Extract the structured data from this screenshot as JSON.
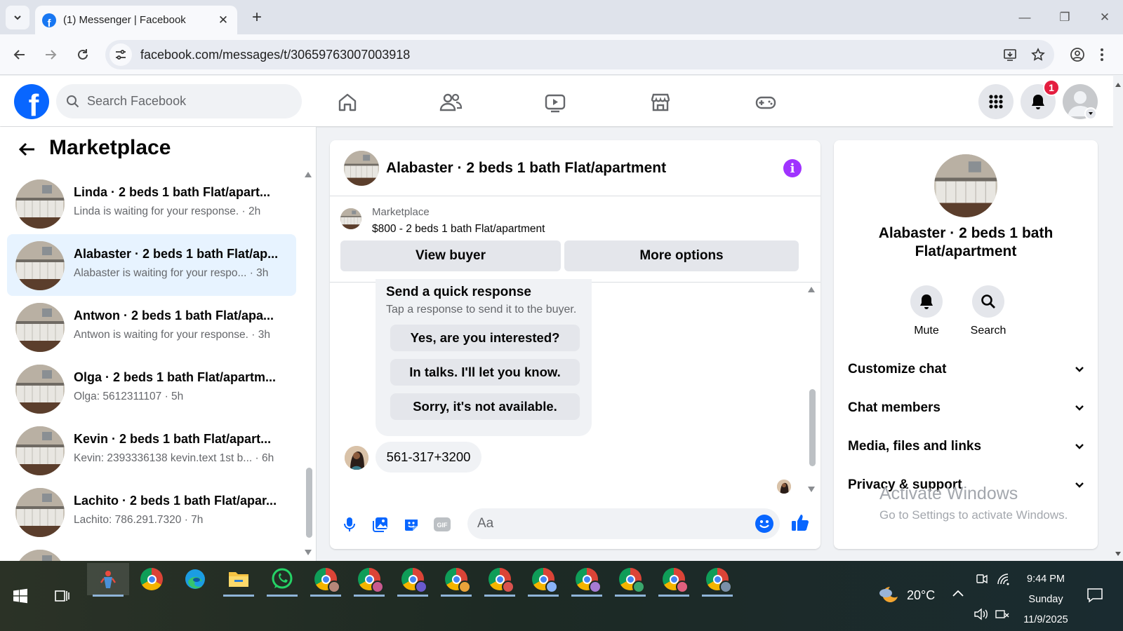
{
  "browser": {
    "tab_title": "(1) Messenger | Facebook",
    "url": "facebook.com/messages/t/30659763007003918"
  },
  "header": {
    "search_placeholder": "Search Facebook",
    "notification_count": "1"
  },
  "left": {
    "title": "Marketplace",
    "conversations": [
      {
        "name": "Linda · 2 beds 1 bath Flat/apart...",
        "snippet": "Linda is waiting for your response. · 2h"
      },
      {
        "name": "Alabaster · 2 beds 1 bath Flat/ap...",
        "snippet": "Alabaster is waiting for your respo... · 3h"
      },
      {
        "name": "Antwon · 2 beds 1 bath Flat/apa...",
        "snippet": "Antwon is waiting for your response. · 3h"
      },
      {
        "name": "Olga · 2 beds 1 bath Flat/apartm...",
        "snippet": "Olga: 5612311107 · 5h"
      },
      {
        "name": "Kevin · 2 beds 1 bath Flat/apart...",
        "snippet": "Kevin: 2393336138 kevin.text 1st b... · 6h"
      },
      {
        "name": "Lachito · 2 beds 1 bath Flat/apar...",
        "snippet": "Lachito: 786.291.7320 · 7h"
      }
    ]
  },
  "chat": {
    "title": "Alabaster · 2 beds 1 bath Flat/apartment",
    "listing_source": "Marketplace",
    "listing_price": "$800 - 2 beds 1 bath Flat/apartment",
    "view_buyer": "View buyer",
    "more_options": "More options",
    "quick_title": "Send a quick response",
    "quick_subtitle": "Tap a response to send it to the buyer.",
    "quick_replies": [
      "Yes, are you interested?",
      "In talks. I'll let you know.",
      "Sorry, it's not available."
    ],
    "message": "561-317+3200",
    "input_placeholder": "Aa"
  },
  "right": {
    "title": "Alabaster · 2 beds 1 bath Flat/apartment",
    "mute": "Mute",
    "search": "Search",
    "sections": [
      "Customize chat",
      "Chat members",
      "Media, files and links",
      "Privacy & support"
    ],
    "watermark_title": "Activate Windows",
    "watermark_sub": "Go to Settings to activate Windows."
  },
  "taskbar": {
    "temperature": "20°C",
    "time": "9:44 PM",
    "day": "Sunday",
    "date": "11/9/2025",
    "profile_colors": [
      "#b5877a",
      "#c85a8f",
      "#6a5acd",
      "#e8a23a",
      "#d9534f",
      "#8ab4f8",
      "#a67bd4",
      "#3aa76d",
      "#e0607e",
      "#7a8fa8"
    ]
  },
  "colors": {
    "brand": "#0866ff",
    "active_row": "#e7f3ff",
    "info": "#a033ff"
  }
}
